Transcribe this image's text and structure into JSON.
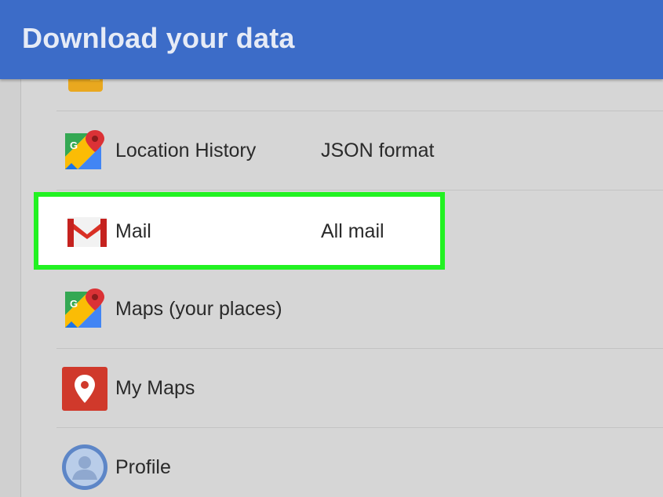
{
  "header": {
    "title": "Download your data"
  },
  "rows": [
    {
      "label": "Location History",
      "value": "JSON format",
      "icon": "google-maps-icon"
    },
    {
      "label": "Mail",
      "value": "All mail",
      "icon": "gmail-icon",
      "highlighted": true
    },
    {
      "label": "Maps (your places)",
      "value": "",
      "icon": "google-maps-icon"
    },
    {
      "label": "My Maps",
      "value": "",
      "icon": "my-maps-icon"
    },
    {
      "label": "Profile",
      "value": "",
      "icon": "profile-icon"
    }
  ],
  "colors": {
    "header": "#3c6cc8",
    "highlight_border": "#22f222",
    "background": "#d6d6d6"
  }
}
